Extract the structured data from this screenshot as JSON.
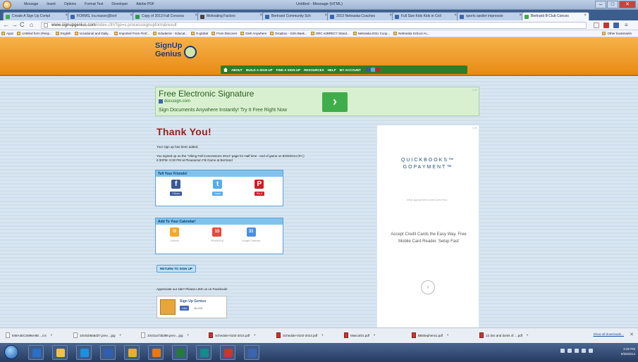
{
  "outlook": {
    "menu": [
      "Message",
      "Insert",
      "Options",
      "Format Text",
      "Developer",
      "Adobe PDF"
    ],
    "title": "Untitled - Message (HTML)"
  },
  "tabs": [
    {
      "label": "Create A Sign Up Compl",
      "color": "#3fae4a"
    },
    {
      "label": "FORMS, Ira.mason@borl",
      "color": "#3b65b0"
    },
    {
      "label": "Copy of 2013 Fall Concess",
      "color": "#2f9a4a"
    },
    {
      "label": "Motivating Factors",
      "color": "#444"
    },
    {
      "label": "Bertrand Community Sch",
      "color": "#3b65b0"
    },
    {
      "label": "2013 Nebraska Coaches",
      "color": "#3b65b0"
    },
    {
      "label": "Full Size Kids Kids in Coll",
      "color": "#3b65b0"
    },
    {
      "label": "sports spoiler impressio",
      "color": "#3b65b0"
    },
    {
      "label": "Bertrand B Club Conces",
      "color": "#3fae4a"
    }
  ],
  "toolbar": {
    "url_host": "www.signupgenius.com",
    "url_path": "/index.cfm?go=s.processsignupform&result"
  },
  "bookmarks": [
    "Apps",
    "Untitled form (Resp...",
    "English",
    "Vocational and Daily...",
    "Imported From Firef...",
    "Edudemic - Educat...",
    "G-global",
    "From Discover",
    "Dish Anywhere",
    "Dropbox - Girls Bask...",
    "ORC e2BREC7 Stand...",
    "Nebraska ESU Coop...",
    "Nebraska School Ac..."
  ],
  "bookmarks_other": "Other bookmarks",
  "site": {
    "logo_line1": "SignUp",
    "logo_line2": "Genius",
    "nav": [
      "ABOUT",
      "BUILD A SIGN UP",
      "FIND A SIGN UP",
      "RESOURCES",
      "HELP",
      "MY ACCOUNT"
    ]
  },
  "ad": {
    "title": "Free Electronic Signature",
    "url": "docusign.com",
    "text": "Sign Documents Anywhere Instantly! Try It Free Right Now",
    "button": "›"
  },
  "content": {
    "heading": "Thank You!",
    "added": "Your sign up has been added.",
    "signed_line1": "You signed up on the \"Viking Fall Concessions 2014\" page for Half time - end of game on 8/29/2014 (Fri.)",
    "signed_line2": "6:30PM- 8:30 PM at Pleasanton FB Game at Bertrand",
    "share_title": "Tell Your Friends!",
    "share": [
      {
        "icon": "f",
        "button": "f Share",
        "color": "#3b5998"
      },
      {
        "icon": "t",
        "button": "Tweet",
        "color": "#55acee"
      },
      {
        "icon": "P",
        "button": "Pin it",
        "color": "#cb2027"
      }
    ],
    "calendar_title": "Add To Your Calendar!",
    "calendar": [
      {
        "icon": "O",
        "label": "Outlook",
        "color": "#f0a92a"
      },
      {
        "icon": "15",
        "label": "iPhone/iCal",
        "color": "#e04b3e"
      },
      {
        "icon": "31",
        "label": "Google Calendar",
        "color": "#4a8fe0"
      }
    ],
    "return_button": "RETURN TO SIGN UP",
    "appreciate": "Appreciate our site? Please LIKE us on Facebook!",
    "fb_name": "Sign Up Genius",
    "fb_like": "Like",
    "fb_count": "36,026"
  },
  "side_ad": {
    "line1": "QUICKBOOKS™",
    "line2": "GOPAYMENT™",
    "url": "intuit-gopayment.com/Card-Rea...",
    "text": "Accept Credit Cards the Easy Way. Free Mobile Card Reader. Setup Fast",
    "arrow": "›"
  },
  "downloads": [
    "848A4ECS896A9E....ics",
    "10c91b8a5d27.prev....jpg",
    "10c01a73bd98.prev....jpg",
    "Schedule-0102-2014.pdf",
    "Schedule-0102-2014.pdf",
    "Mascot01.pdf",
    "BBStephens1.pdf",
    "12 dos and donts of ....pdf"
  ],
  "downloads_show_all": "Show all downloads...",
  "taskbar": {
    "apps": [
      {
        "name": "outlook",
        "color": "#2a6fc9"
      },
      {
        "name": "explorer",
        "color": "#f0c24a"
      },
      {
        "name": "ie",
        "color": "#1d8fe0"
      },
      {
        "name": "word",
        "color": "#2f5fb3"
      },
      {
        "name": "chrome",
        "color": "#e3b12b"
      },
      {
        "name": "media",
        "color": "#e07a1f"
      },
      {
        "name": "excel",
        "color": "#237a3b"
      },
      {
        "name": "publisher",
        "color": "#158a8a"
      },
      {
        "name": "acrobat",
        "color": "#c8362e"
      },
      {
        "name": "paint",
        "color": "#3b65b0"
      }
    ],
    "time": "2:32 PM",
    "date": "8/25/2014"
  }
}
